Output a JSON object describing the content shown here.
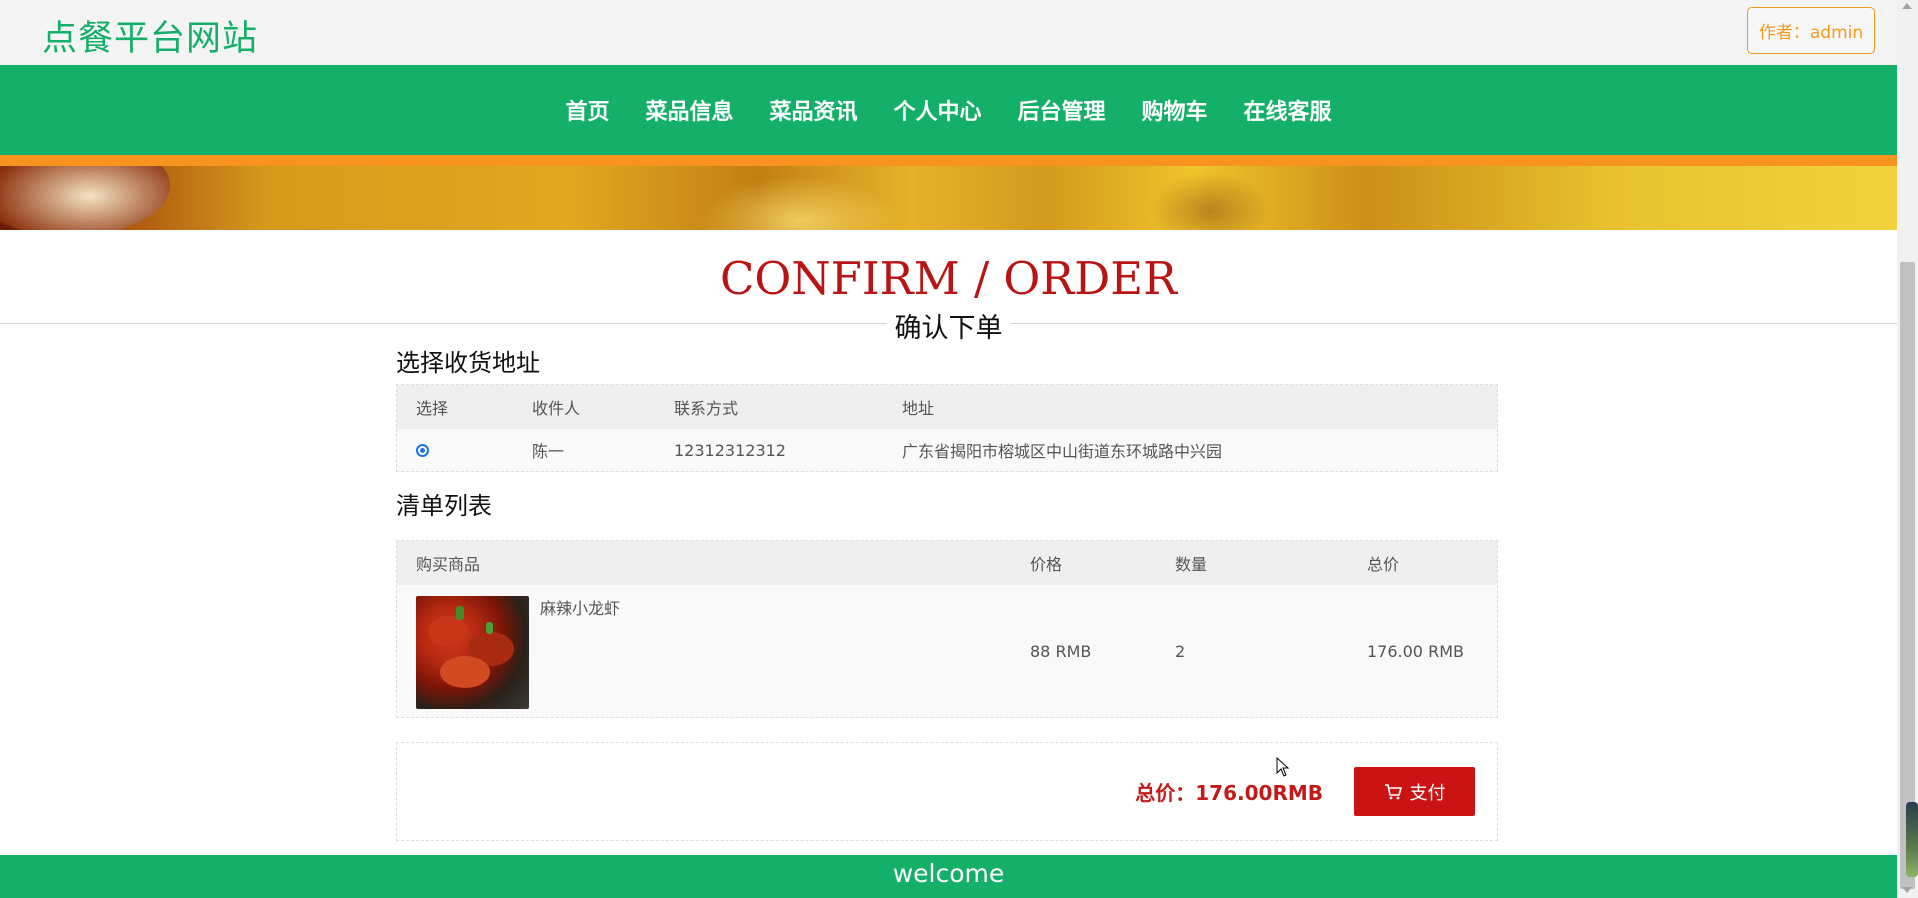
{
  "header": {
    "site_title": "点餐平台网站",
    "author_label": "作者：admin"
  },
  "nav": {
    "items": [
      "首页",
      "菜品信息",
      "菜品资讯",
      "个人中心",
      "后台管理",
      "购物车",
      "在线客服"
    ]
  },
  "page_heading": {
    "english": "CONFIRM / ORDER",
    "chinese": "确认下单"
  },
  "address_section": {
    "title": "选择收货地址",
    "columns": [
      "选择",
      "收件人",
      "联系方式",
      "地址"
    ],
    "rows": [
      {
        "selected": true,
        "recipient": "陈一",
        "phone": "12312312312",
        "address": "广东省揭阳市榕城区中山街道东环城路中兴园"
      }
    ]
  },
  "list_section": {
    "title": "清单列表",
    "columns": [
      "购买商品",
      "价格",
      "数量",
      "总价"
    ],
    "rows": [
      {
        "name": "麻辣小龙虾",
        "price": "88 RMB",
        "quantity": "2",
        "total": "176.00 RMB",
        "image_icon": "crayfish-photo"
      }
    ]
  },
  "payment": {
    "total_text": "总价：176.00RMB",
    "pay_label": "支付",
    "pay_icon": "cart-icon"
  },
  "footer": {
    "text": "welcome"
  },
  "colors": {
    "brand_green": "#14b069",
    "accent_orange": "#f7931e",
    "heading_red": "#b91414",
    "pay_red": "#cc1313"
  }
}
